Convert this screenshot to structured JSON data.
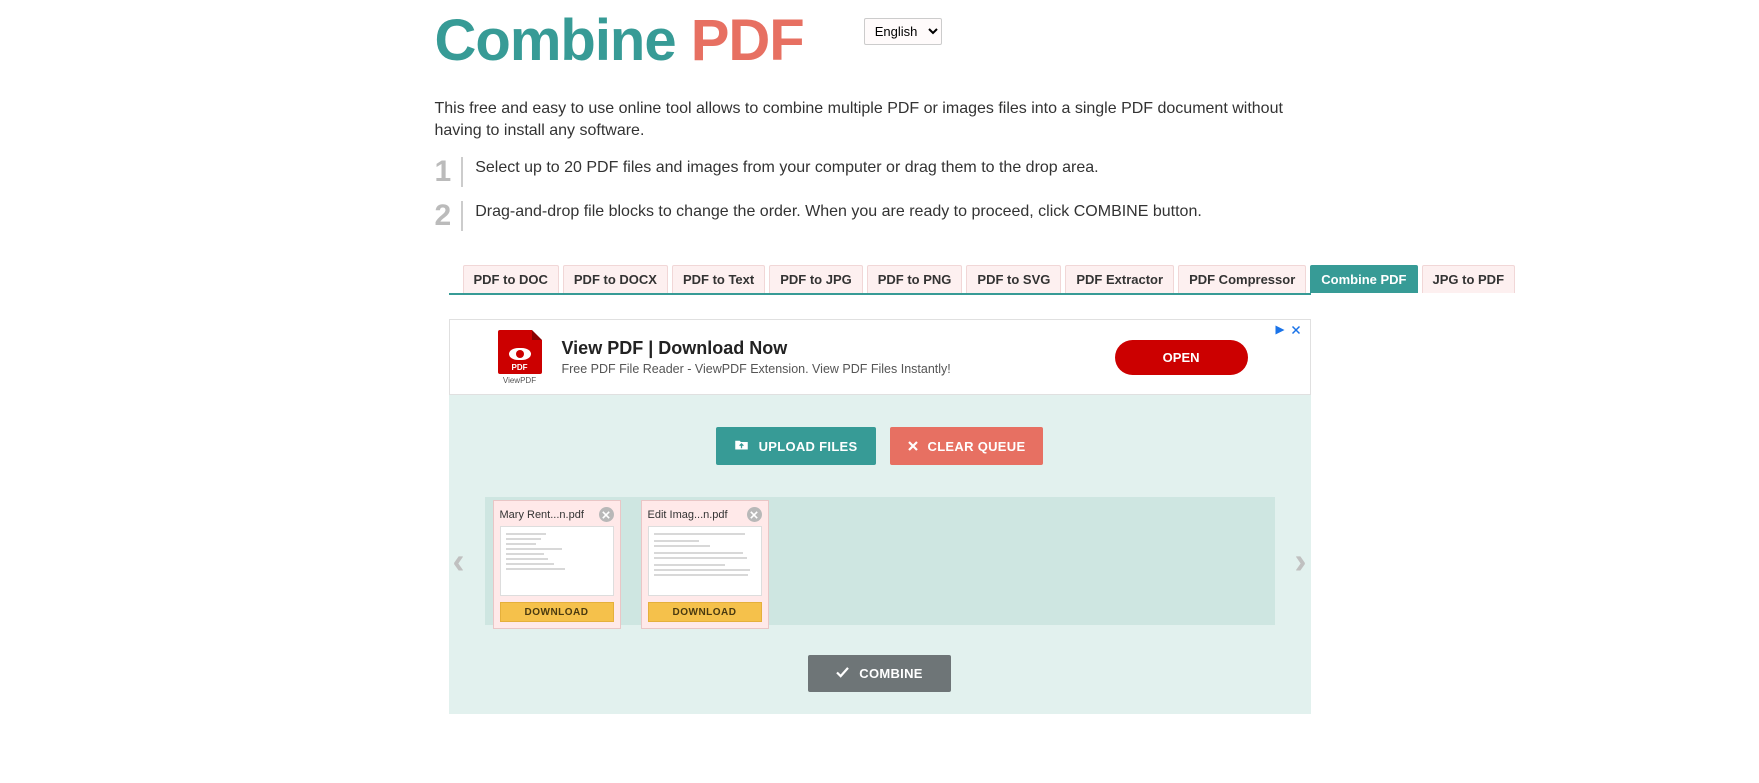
{
  "logo": {
    "part1": "Combine ",
    "part2": "PDF"
  },
  "language": {
    "selected": "English",
    "options": [
      "English"
    ]
  },
  "description": "This free and easy to use online tool allows to combine multiple PDF or images files into a single PDF document without having to install any software.",
  "steps": [
    {
      "num": "1",
      "text": "Select up to 20 PDF files and images from your computer or drag them to the drop area."
    },
    {
      "num": "2",
      "text": "Drag-and-drop file blocks to change the order. When you are ready to proceed, click COMBINE button."
    }
  ],
  "tabs": [
    {
      "label": "PDF to DOC",
      "active": false
    },
    {
      "label": "PDF to DOCX",
      "active": false
    },
    {
      "label": "PDF to Text",
      "active": false
    },
    {
      "label": "PDF to JPG",
      "active": false
    },
    {
      "label": "PDF to PNG",
      "active": false
    },
    {
      "label": "PDF to SVG",
      "active": false
    },
    {
      "label": "PDF Extractor",
      "active": false
    },
    {
      "label": "PDF Compressor",
      "active": false
    },
    {
      "label": "Combine PDF",
      "active": true
    },
    {
      "label": "JPG to PDF",
      "active": false
    }
  ],
  "ad": {
    "pdf_badge": "PDF",
    "sublabel": "ViewPDF",
    "title": "View PDF | Download Now",
    "subtitle": "Free PDF File Reader - ViewPDF Extension. View PDF Files Instantly!",
    "cta": "OPEN"
  },
  "buttons": {
    "upload": "UPLOAD FILES",
    "clear": "CLEAR QUEUE",
    "combine": "COMBINE"
  },
  "files": [
    {
      "name": "Mary Rent...n.pdf",
      "download": "DOWNLOAD"
    },
    {
      "name": "Edit Imag...n.pdf",
      "download": "DOWNLOAD"
    }
  ],
  "nav": {
    "left": "‹",
    "right": "›"
  }
}
